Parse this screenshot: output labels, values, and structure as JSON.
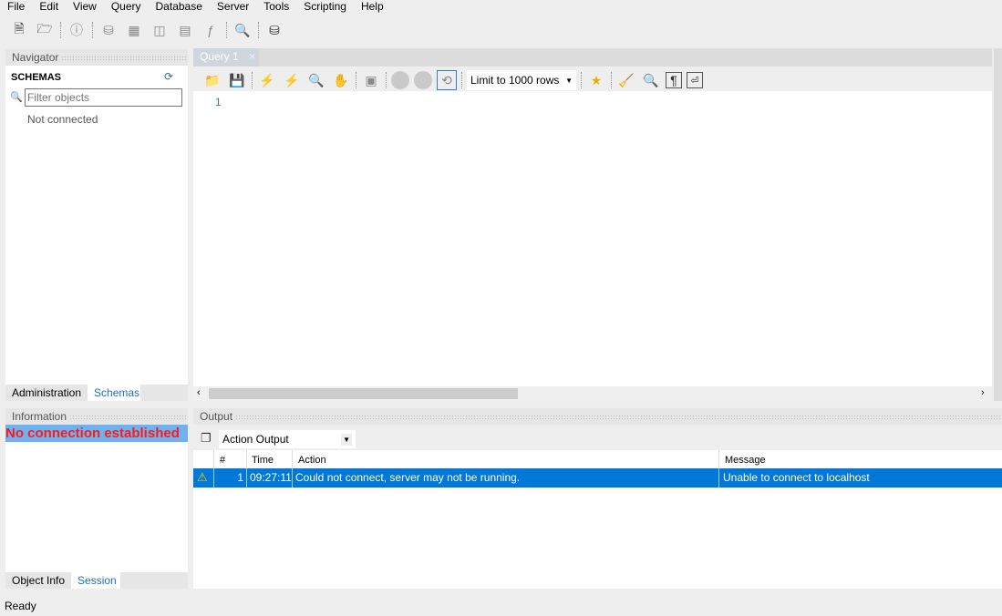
{
  "menu": [
    "File",
    "Edit",
    "View",
    "Query",
    "Database",
    "Server",
    "Tools",
    "Scripting",
    "Help"
  ],
  "main_toolbar": [
    "new-sql-tab-icon",
    "open-sql-file-icon",
    "schema-inspector-icon",
    "create-schema-icon",
    "create-table-icon",
    "create-view-icon",
    "create-procedure-icon",
    "create-function-icon",
    "search-table-data-icon",
    "reconnect-icon"
  ],
  "navigator": {
    "title": "Navigator",
    "schemas_label": "SCHEMAS",
    "filter_placeholder": "Filter objects",
    "status": "Not connected",
    "tabs": [
      "Administration",
      "Schemas"
    ]
  },
  "information": {
    "title": "Information",
    "message": "No connection established",
    "tabs": [
      "Object Info",
      "Session"
    ]
  },
  "query": {
    "tab_label": "Query 1",
    "close": "×",
    "limit_label": "Limit to 1000 rows",
    "line_number": "1"
  },
  "output": {
    "title": "Output",
    "selector": "Action Output",
    "columns": [
      "#",
      "Time",
      "Action",
      "Message"
    ],
    "rows": [
      {
        "status": "warning",
        "num": "1",
        "time": "09:27:11",
        "action": "Could not connect, server may not be running.",
        "message": "Unable to connect to localhost"
      }
    ]
  },
  "status_bar": "Ready",
  "colors": {
    "selection": "#0078d7",
    "error_text": "#ff1a1a",
    "info_highlight": "#6fb2f0"
  }
}
